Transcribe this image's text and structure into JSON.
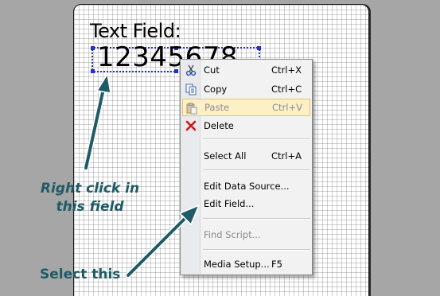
{
  "label": {
    "title": "Text Field:",
    "value": "12345678"
  },
  "menu": {
    "items": [
      {
        "label": "Cut",
        "shortcut": "Ctrl+X",
        "icon": "scissors-icon",
        "state": "normal"
      },
      {
        "label": "Copy",
        "shortcut": "Ctrl+C",
        "icon": "copy-icon",
        "state": "normal"
      },
      {
        "label": "Paste",
        "shortcut": "Ctrl+V",
        "icon": "paste-icon",
        "state": "hover-disabled"
      },
      {
        "label": "Delete",
        "shortcut": "",
        "icon": "delete-icon",
        "state": "normal"
      },
      {
        "label": "Select All",
        "shortcut": "Ctrl+A",
        "icon": "",
        "state": "normal"
      },
      {
        "label": "Edit Data Source...",
        "shortcut": "",
        "icon": "",
        "state": "normal"
      },
      {
        "label": "Edit Field...",
        "shortcut": "",
        "icon": "",
        "state": "normal"
      },
      {
        "label": "Find Script...",
        "shortcut": "",
        "icon": "",
        "state": "disabled"
      },
      {
        "label": "Media Setup...",
        "shortcut": "F5",
        "icon": "",
        "state": "normal"
      }
    ]
  },
  "annotations": {
    "right_click_line1": "Right click in",
    "right_click_line2": "this field",
    "select_this": "Select this"
  },
  "colors": {
    "annotation": "#1f5b66",
    "selection": "#1f2fd0",
    "menu_hover": "#fdf0c6",
    "delete_icon": "#d01818"
  }
}
